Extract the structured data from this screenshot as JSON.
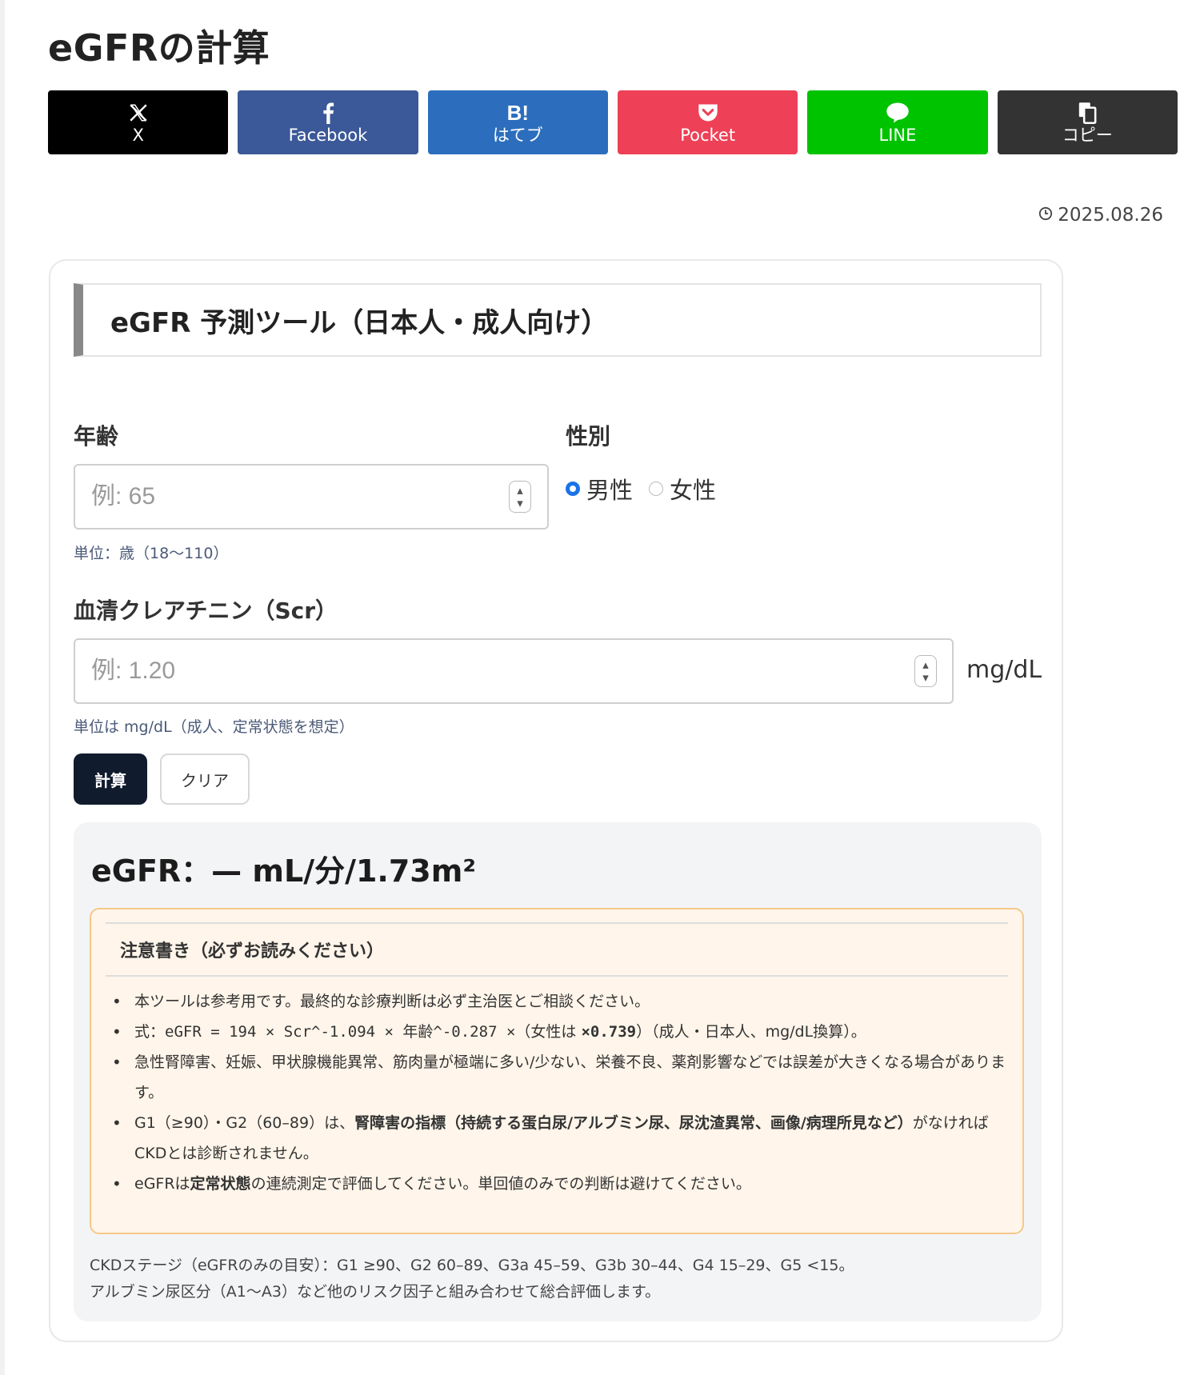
{
  "page": {
    "title": "eGFRの計算",
    "date": "2025.08.26"
  },
  "share": [
    {
      "key": "x",
      "label": "X"
    },
    {
      "key": "facebook",
      "label": "Facebook"
    },
    {
      "key": "hatena",
      "label": "はてブ",
      "icon_text": "B!"
    },
    {
      "key": "pocket",
      "label": "Pocket"
    },
    {
      "key": "line",
      "label": "LINE"
    },
    {
      "key": "copy",
      "label": "コピー"
    }
  ],
  "tool": {
    "heading": "eGFR 予測ツール（日本人・成人向け）",
    "age": {
      "label": "年齢",
      "placeholder": "例: 65",
      "hint": "単位：歳（18〜110）"
    },
    "sex": {
      "label": "性別",
      "options": [
        "男性",
        "女性"
      ],
      "selected": "男性"
    },
    "scr": {
      "label": "血清クレアチニン（Scr）",
      "placeholder": "例: 1.20",
      "unit": "mg/dL",
      "hint": "単位は mg/dL（成人、定常状態を想定）"
    },
    "buttons": {
      "calc": "計算",
      "clear": "クリア"
    },
    "result": {
      "label": "eGFR：— mL/分/1.73m²"
    },
    "notes": {
      "title": "注意書き（必ずお読みください）",
      "items": [
        "本ツールは参考用です。最終的な診療判断は必ず主治医とご相談ください。",
        {
          "prefix": "式：",
          "formula": "eGFR = 194 × Scr^-1.094 × 年齢^-0.287 ×",
          "mid": "（女性は ",
          "factor": "×0.739",
          "suffix": "）（成人・日本人、mg/dL換算）。"
        },
        "急性腎障害、妊娠、甲状腺機能異常、筋肉量が極端に多い/少ない、栄養不良、薬剤影響などでは誤差が大きくなる場合があります。",
        {
          "prefix": "G1（≥90）・G2（60–89）は、",
          "bold": "腎障害の指標（持続する蛋白尿/アルブミン尿、尿沈渣異常、画像/病理所見など）",
          "suffix": "がなければCKDとは診断されません。"
        },
        {
          "prefix": "eGFRは",
          "bold": "定常状態",
          "suffix": "の連続測定で評価してください。単回値のみでの判断は避けてください。"
        }
      ]
    },
    "stages": {
      "line1": "CKDステージ（eGFRのみの目安）：G1 ≥90、G2 60–89、G3a 45–59、G3b 30–44、G4 15–29、G5 <15。",
      "line2": "アルブミン尿区分（A1〜A3）など他のリスク因子と組み合わせて総合評価します。"
    }
  },
  "colors": {
    "x": "#000000",
    "facebook": "#3b5998",
    "hatena": "#2c6ebd",
    "pocket": "#ee4056",
    "line": "#00c300",
    "copy": "#333333",
    "calc_button": "#111b2e",
    "radio_accent": "#1a73e8",
    "note_border": "#f6c88a",
    "note_bg": "#fff5ea",
    "result_bg": "#f3f4f6"
  },
  "icons": {
    "x": "x-logo-icon",
    "facebook": "facebook-f-icon",
    "hatena": "hatena-b-icon",
    "pocket": "pocket-icon",
    "line": "line-bubble-icon",
    "copy": "copy-icon",
    "date": "clock-icon"
  }
}
